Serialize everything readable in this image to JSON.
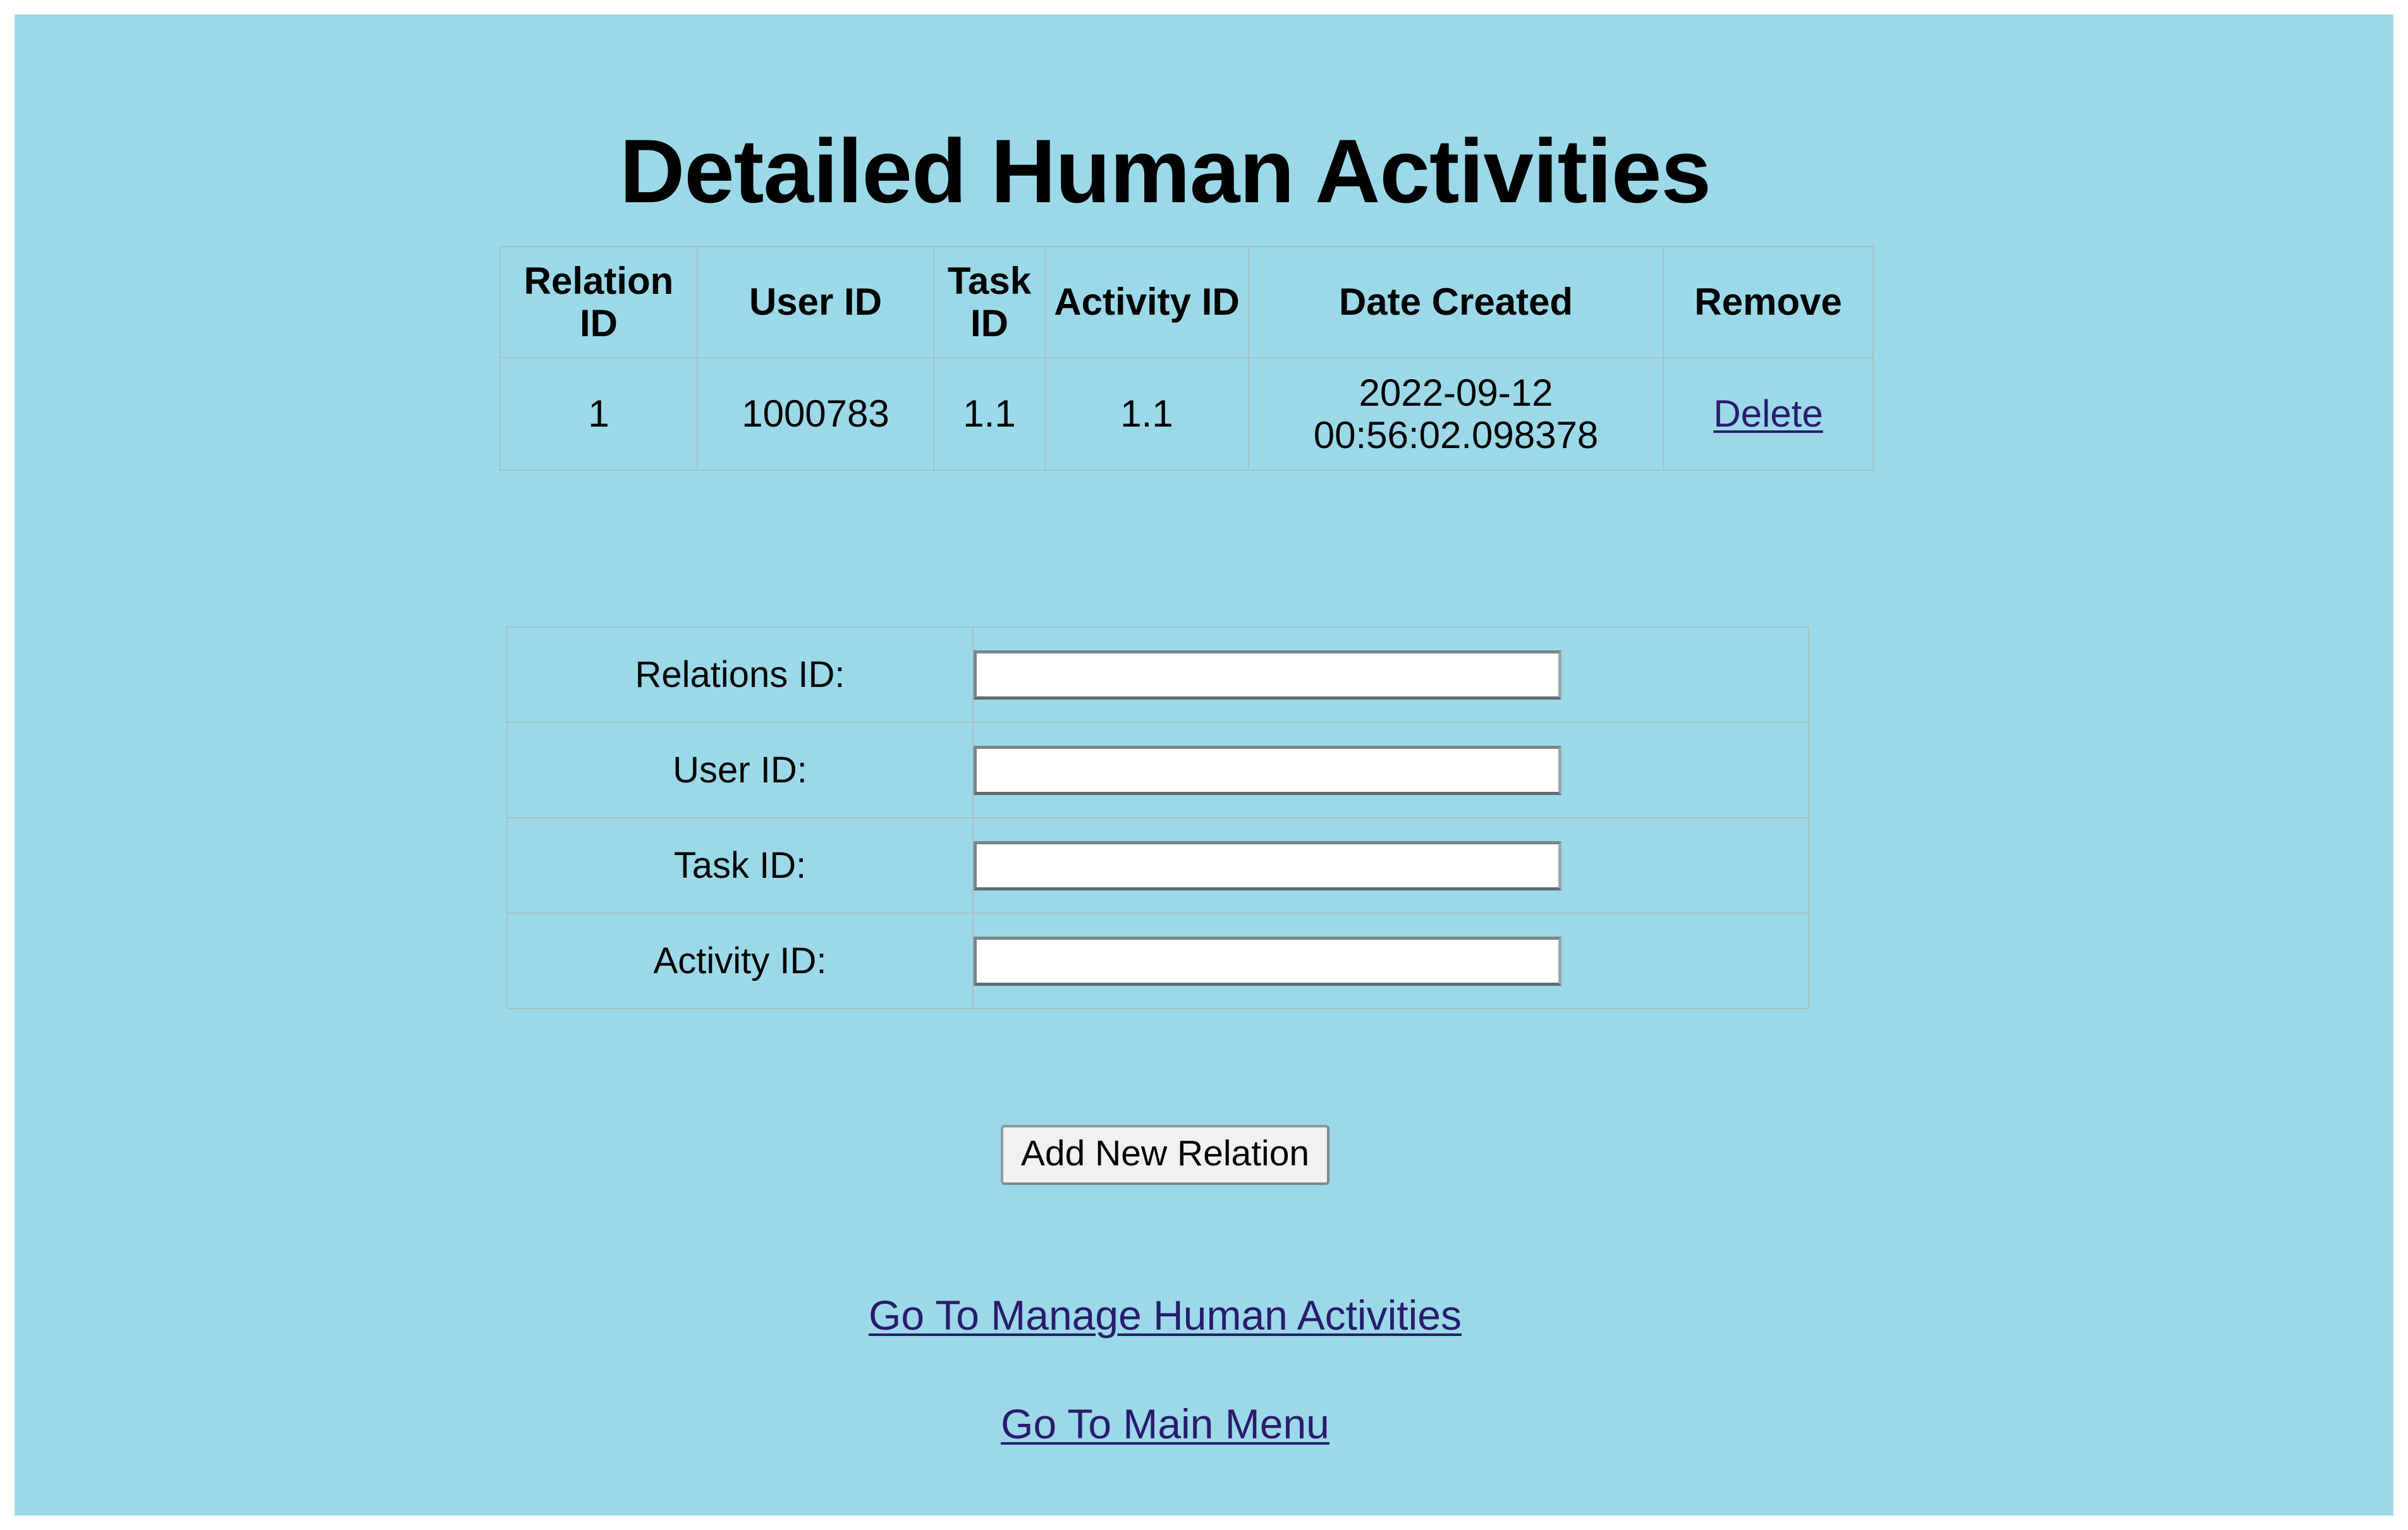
{
  "page": {
    "background_color": "#9bd9e8",
    "title": "Detailed Human Activities"
  },
  "data_table": {
    "headers": {
      "relation_id": "Relation ID",
      "user_id": "User ID",
      "task_id": "Task ID",
      "activity_id": "Activity ID",
      "date_created": "Date Created",
      "remove": "Remove"
    },
    "rows": [
      {
        "relation_id": "1",
        "user_id": "1000783",
        "task_id": "1.1",
        "activity_id": "1.1",
        "date_created": "2022-09-12 00:56:02.098378",
        "remove_label": "Delete"
      }
    ]
  },
  "form": {
    "fields": [
      {
        "label": "Relations ID:",
        "value": "",
        "placeholder": ""
      },
      {
        "label": "User ID:",
        "value": "",
        "placeholder": ""
      },
      {
        "label": "Task ID:",
        "value": "",
        "placeholder": ""
      },
      {
        "label": "Activity ID:",
        "value": "",
        "placeholder": ""
      }
    ],
    "submit_label": "Add New Relation"
  },
  "nav": {
    "manage_label": "Go To Manage Human Activities",
    "main_menu_label": "Go To Main Menu",
    "link_color": "#2a1b6e"
  }
}
